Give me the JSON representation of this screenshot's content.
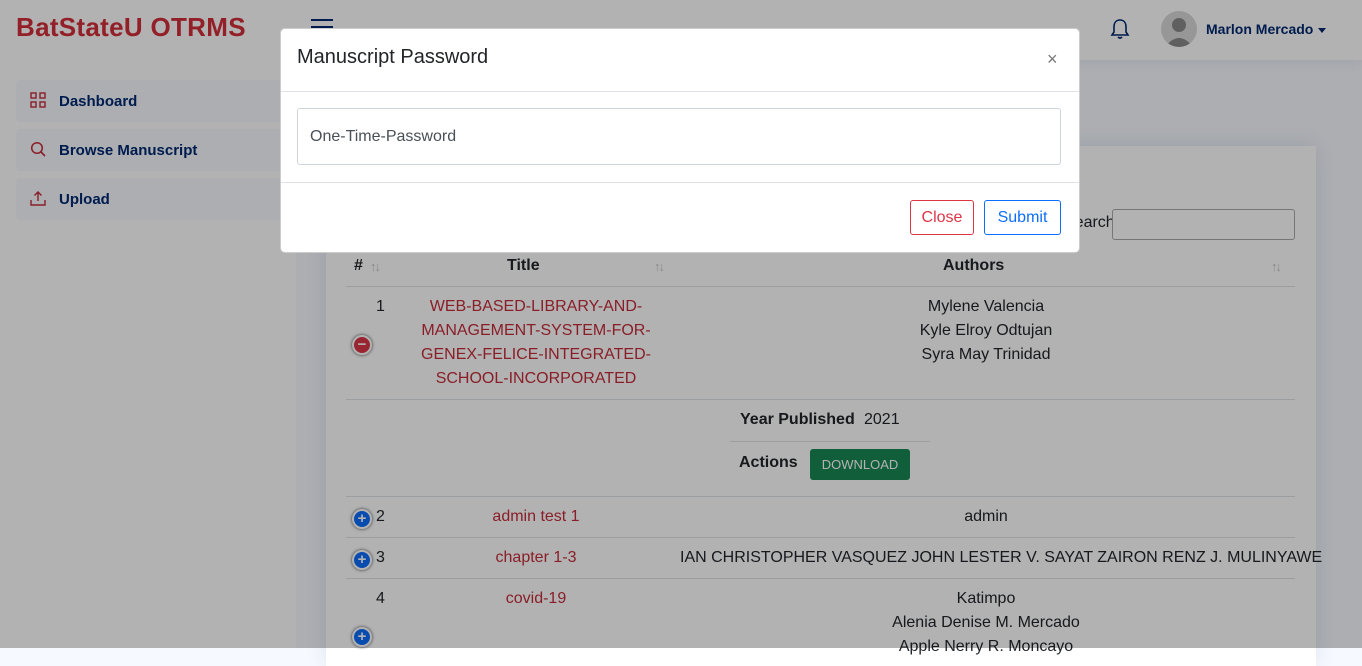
{
  "header": {
    "logo": "BatStateU OTRMS",
    "user_name": "Marlon Mercado"
  },
  "sidebar": {
    "items": [
      {
        "label": "Dashboard",
        "icon": "grid-icon"
      },
      {
        "label": "Browse Manuscript",
        "icon": "search-icon"
      },
      {
        "label": "Upload",
        "icon": "upload-icon"
      }
    ]
  },
  "table": {
    "search_label": "Search:",
    "columns": [
      "#",
      "Title",
      "Authors"
    ],
    "rows": [
      {
        "num": "1",
        "title_lines": [
          "WEB-BASED-LIBRARY-AND-",
          "MANAGEMENT-SYSTEM-FOR-",
          "GENEX-FELICE-INTEGRATED-",
          "SCHOOL-INCORPORATED"
        ],
        "authors": [
          "Mylene Valencia",
          "Kyle Elroy Odtujan",
          "Syra May Trinidad"
        ],
        "expanded": true
      },
      {
        "num": "2",
        "title": "admin test 1",
        "authors": "admin"
      },
      {
        "num": "3",
        "title": "chapter 1-3",
        "authors": "IAN CHRISTOPHER VASQUEZ JOHN LESTER V. SAYAT ZAIRON RENZ J. MULINYAWE"
      },
      {
        "num": "4",
        "title": "covid-19",
        "authors": [
          "Katimpo",
          "Alenia Denise M. Mercado",
          "Apple Nerry R. Moncayo"
        ]
      }
    ],
    "detail": {
      "year_label": "Year Published",
      "year_value": "2021",
      "actions_label": "Actions",
      "download_label": "DOWNLOAD"
    }
  },
  "modal": {
    "title": "Manuscript Password",
    "close_symbol": "×",
    "input_placeholder": "One-Time-Password",
    "close_label": "Close",
    "submit_label": "Submit"
  },
  "colors": {
    "brand": "#d32f3b",
    "nav": "#012970",
    "link": "#c52c3a",
    "success": "#198754",
    "primary": "#0d6efd",
    "danger": "#dc3545"
  }
}
